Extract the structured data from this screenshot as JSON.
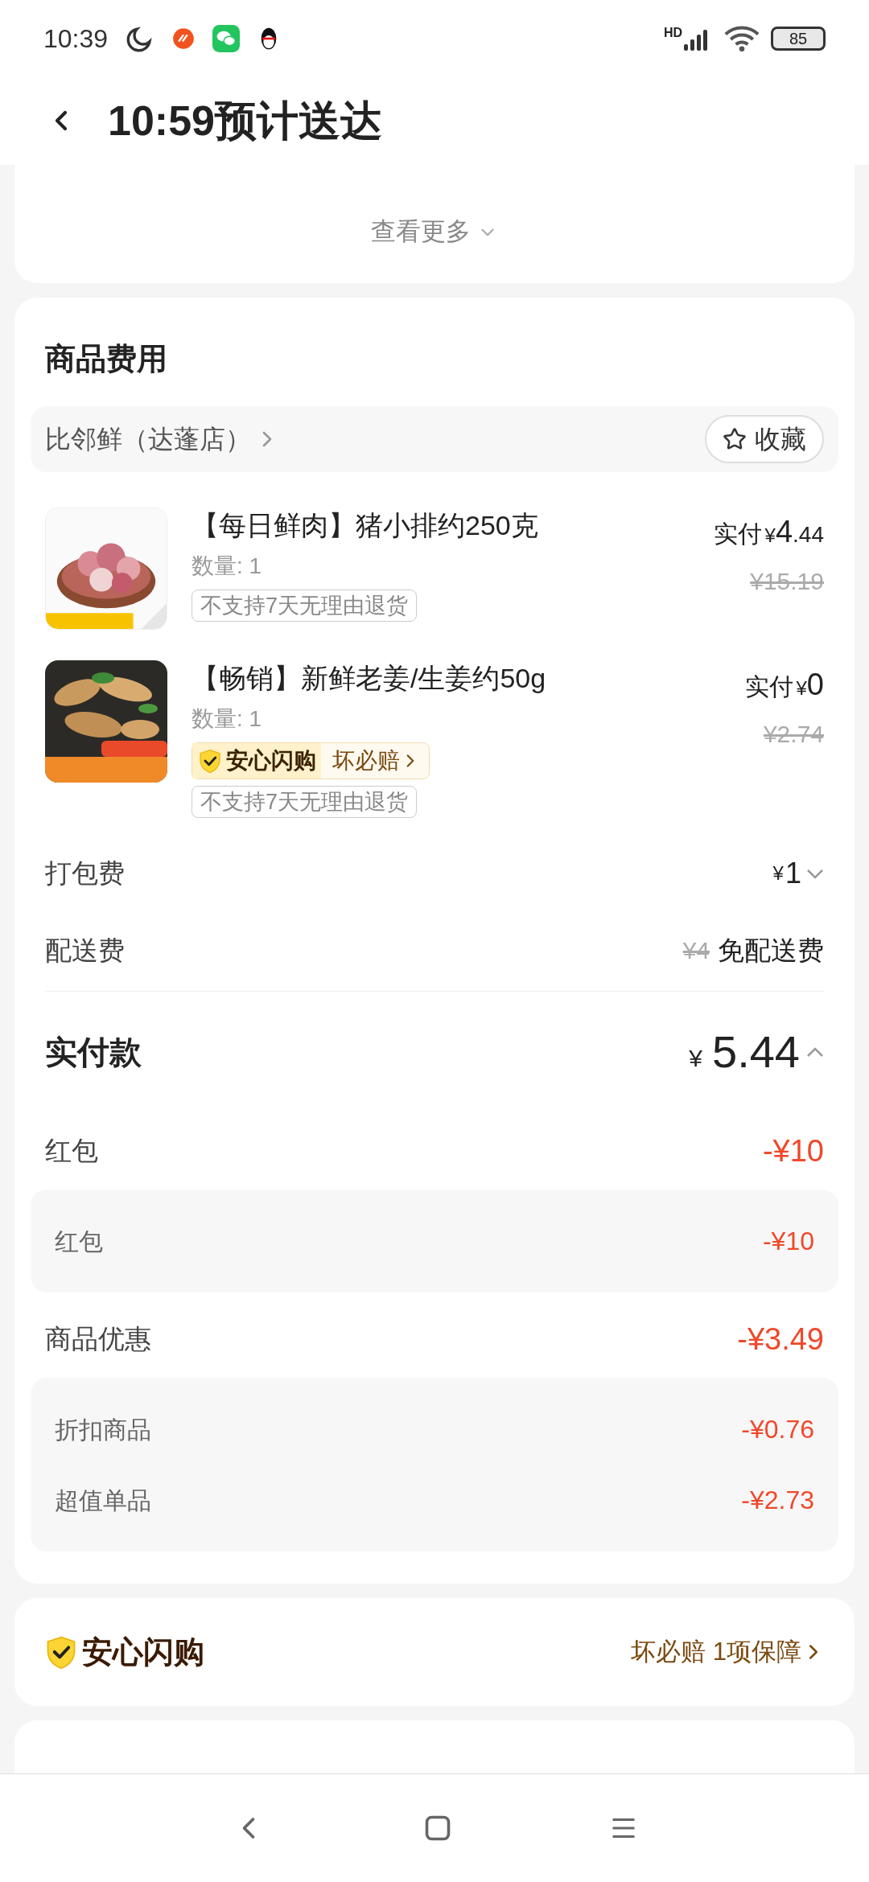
{
  "status_bar": {
    "time": "10:39",
    "network": "HD",
    "battery": "85"
  },
  "header": {
    "title": "10:59预计送达"
  },
  "top_card": {
    "more_link": "查看更多"
  },
  "fees_card": {
    "title": "商品费用",
    "store": {
      "name": "比邻鲜（达蓬店）",
      "favorite": "收藏"
    },
    "items": [
      {
        "name": "【每日鲜肉】猪小排约250克",
        "quantity": "数量: 1",
        "paid_label": "实付",
        "currency": "¥",
        "amount": "4",
        "decimals": ".44",
        "original_price": "¥15.19",
        "tags": [
          "不支持7天无理由退货"
        ]
      },
      {
        "name": "【畅销】新鲜老姜/生姜约50g",
        "quantity": "数量: 1",
        "paid_label": "实付",
        "currency": "¥",
        "amount": "0",
        "original_price": "¥2.74",
        "badge": {
          "title": "安心闪购",
          "link": "坏必赔"
        },
        "tags": [
          "不支持7天无理由退货"
        ]
      }
    ],
    "packing": {
      "label": "打包费",
      "currency": "¥",
      "amount": "1",
      "expanded": false
    },
    "delivery": {
      "label": "配送费",
      "original": "¥4",
      "value": "免配送费"
    },
    "total": {
      "label": "实付款",
      "currency": "¥",
      "amount": "5.44",
      "expanded": true
    },
    "discounts": [
      {
        "label": "红包",
        "amount": "-¥10",
        "details": [
          {
            "label": "红包",
            "amount": "-¥10"
          }
        ]
      },
      {
        "label": "商品优惠",
        "amount": "-¥3.49",
        "details": [
          {
            "label": "折扣商品",
            "amount": "-¥0.76"
          },
          {
            "label": "超值单品",
            "amount": "-¥2.73"
          }
        ]
      }
    ]
  },
  "guarantee_card": {
    "title": "安心闪购",
    "link": "坏必赔 1项保障"
  }
}
